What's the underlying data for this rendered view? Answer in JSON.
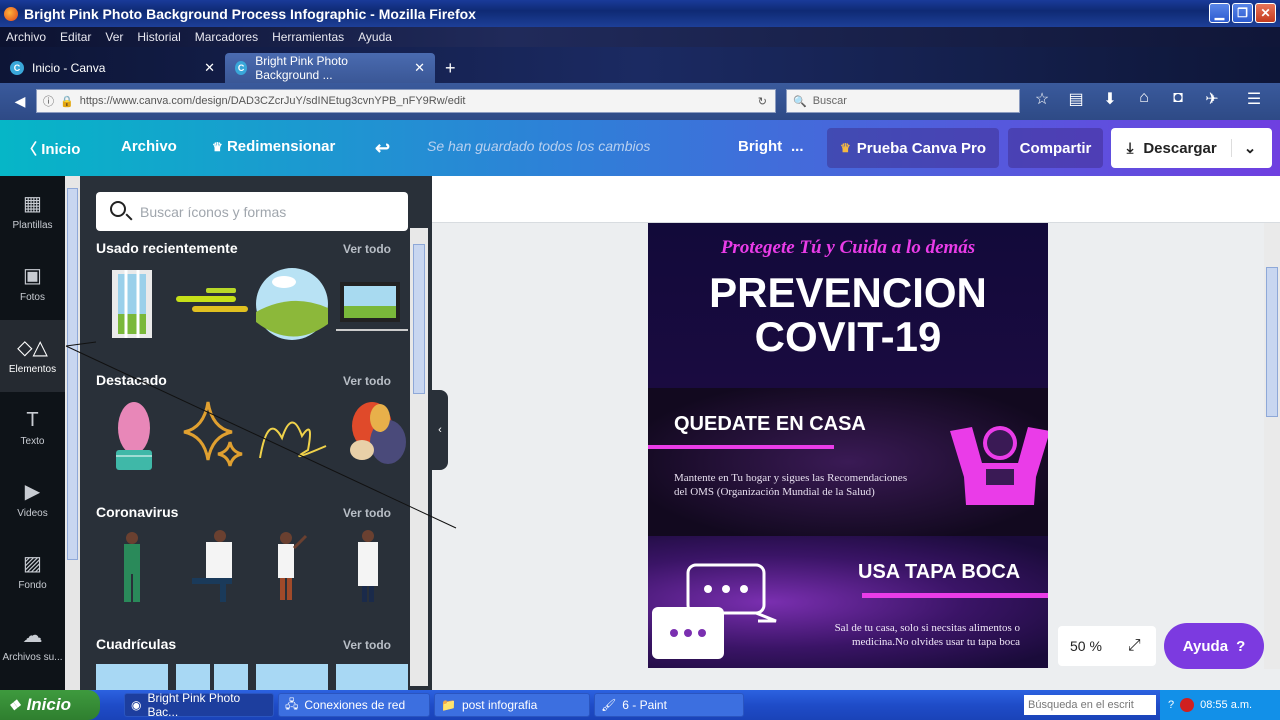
{
  "window": {
    "title": "Bright Pink Photo Background Process Infographic - Mozilla Firefox"
  },
  "menu": [
    "Archivo",
    "Editar",
    "Ver",
    "Historial",
    "Marcadores",
    "Herramientas",
    "Ayuda"
  ],
  "tabs": [
    {
      "label": "Inicio - Canva"
    },
    {
      "label": "Bright Pink Photo Background ..."
    }
  ],
  "url": "https://www.canva.com/design/DAD3CZcrJuY/sdINEtug3cvnYPB_nFY9Rw/edit",
  "search_placeholder": "Buscar",
  "canva": {
    "home": "Inicio",
    "file": "Archivo",
    "resize": "Redimensionar",
    "saved": "Se han guardado todos los cambios",
    "design_name": "Bright",
    "ellipsis": "...",
    "pro": "Prueba Canva Pro",
    "share": "Compartir",
    "download": "Descargar"
  },
  "sidebar": [
    {
      "label": "Plantillas",
      "icon": "templates-icon"
    },
    {
      "label": "Fotos",
      "icon": "photos-icon"
    },
    {
      "label": "Elementos",
      "icon": "elements-icon"
    },
    {
      "label": "Texto",
      "icon": "text-icon"
    },
    {
      "label": "Videos",
      "icon": "video-icon"
    },
    {
      "label": "Fondo",
      "icon": "background-icon"
    },
    {
      "label": "Archivos su...",
      "icon": "upload-icon"
    }
  ],
  "panel": {
    "search_placeholder": "Buscar íconos y formas",
    "see_all": "Ver todo",
    "sections": [
      "Usado recientemente",
      "Destacado",
      "Coronavirus",
      "Cuadrículas"
    ]
  },
  "design": {
    "script": "Protegete Tú y Cuida a lo demás",
    "title1": "PREVENCION",
    "title2": "COVIT-19",
    "h1": "QUEDATE EN CASA",
    "p1a": "Mantente en Tu hogar y sigues las Recomendaciones",
    "p1b": "del OMS (Organización Mundial de la Salud)",
    "h2": "USA TAPA BOCA",
    "p2a": "Sal de tu casa, solo si necsitas alimentos o",
    "p2b": "medicina.No olvides usar tu tapa boca",
    "colors": {
      "pink": "#ea3ce8",
      "navy": "#120a3a"
    }
  },
  "zoom": "50 %",
  "help": "Ayuda",
  "help_mark": "?",
  "taskbar": {
    "start": "Inicio",
    "tasks": [
      "Bright Pink Photo Bac...",
      "Conexiones de red",
      "post infografia",
      "6 - Paint"
    ],
    "search": "Búsqueda en el escrit",
    "time": "08:55 a.m."
  }
}
